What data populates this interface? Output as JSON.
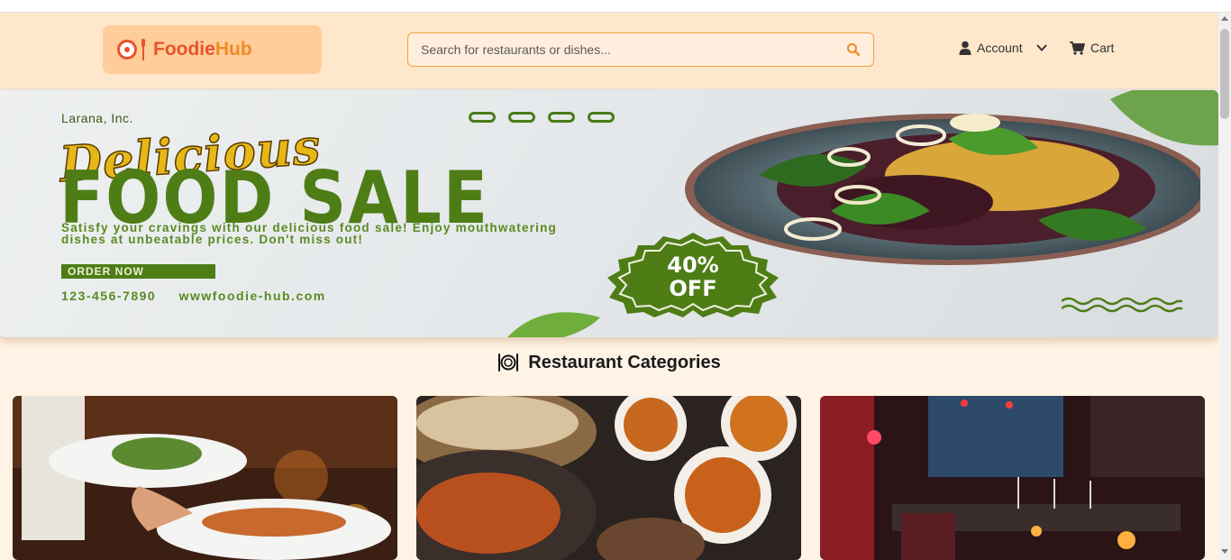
{
  "brand": {
    "name_part1": "Foodie",
    "name_part2": "Hub",
    "colors": {
      "primary": "#e8532b",
      "accent": "#f08a24",
      "header_bg": "#ffe7cc",
      "page_bg": "#fff3e6"
    }
  },
  "header": {
    "search_placeholder": "Search for restaurants or dishes...",
    "search_icon": "search-icon",
    "account_label": "Account",
    "account_icon": "user-icon",
    "dropdown_icon": "chevron-down-icon",
    "cart_label": "Cart",
    "cart_icon": "cart-icon"
  },
  "banner": {
    "company": "Larana, Inc.",
    "script_title": "Delicious",
    "main_title": "FOOD SALE",
    "description": "Satisfy your cravings with our delicious food sale! Enjoy mouthwatering dishes at unbeatable prices. Don't miss out!",
    "cta": "ORDER NOW",
    "phone": "123-456-7890",
    "website": "wwwfoodie-hub.com",
    "badge_line1": "40%",
    "badge_line2": "OFF"
  },
  "categories": {
    "title": "Restaurant Categories",
    "icon": "plate-utensils-icon",
    "cards": [
      {
        "image": "waiter-serving-plates-photo"
      },
      {
        "image": "indian-curry-dishes-photo"
      },
      {
        "image": "fine-dining-interior-photo"
      }
    ]
  }
}
